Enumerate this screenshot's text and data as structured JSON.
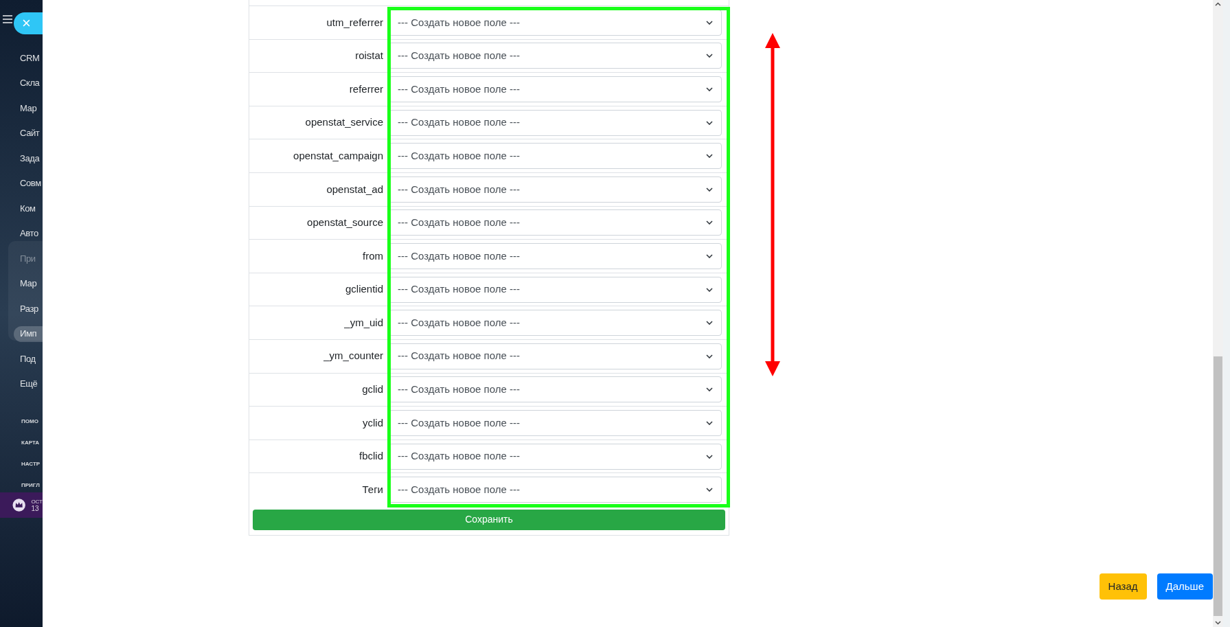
{
  "sidebar": {
    "close_button": "×",
    "items": [
      {
        "label": "CRM",
        "dimmed": false,
        "selected": false
      },
      {
        "label": "Скла",
        "dimmed": false,
        "selected": false
      },
      {
        "label": "Мар",
        "dimmed": false,
        "selected": false
      },
      {
        "label": "Сайт",
        "dimmed": false,
        "selected": false
      },
      {
        "label": "Зада",
        "dimmed": false,
        "selected": false
      },
      {
        "label": "Совм",
        "dimmed": false,
        "selected": false
      },
      {
        "label": "Ком",
        "dimmed": false,
        "selected": false
      },
      {
        "label": "Авто",
        "dimmed": false,
        "selected": false
      },
      {
        "label": "При",
        "dimmed": true,
        "selected": false
      },
      {
        "label": "Мар",
        "dimmed": false,
        "selected": false
      },
      {
        "label": "Разр",
        "dimmed": false,
        "selected": false
      },
      {
        "label": "Имп",
        "dimmed": false,
        "selected": true
      },
      {
        "label": "Под",
        "dimmed": false,
        "selected": false
      },
      {
        "label": "Ещё",
        "dimmed": false,
        "selected": false
      }
    ],
    "links": [
      "ПОМО",
      "КАРТА",
      "НАСТР",
      "ПРИГЛ"
    ],
    "plan": {
      "line_1": "ОСТ",
      "line_2": "13"
    }
  },
  "mapping": {
    "rows": [
      {
        "field": "utm_referrer",
        "value": "--- Создать новое поле ---"
      },
      {
        "field": "roistat",
        "value": "--- Создать новое поле ---"
      },
      {
        "field": "referrer",
        "value": "--- Создать новое поле ---"
      },
      {
        "field": "openstat_service",
        "value": "--- Создать новое поле ---"
      },
      {
        "field": "openstat_campaign",
        "value": "--- Создать новое поле ---"
      },
      {
        "field": "openstat_ad",
        "value": "--- Создать новое поле ---"
      },
      {
        "field": "openstat_source",
        "value": "--- Создать новое поле ---"
      },
      {
        "field": "from",
        "value": "--- Создать новое поле ---"
      },
      {
        "field": "gclientid",
        "value": "--- Создать новое поле ---"
      },
      {
        "field": "_ym_uid",
        "value": "--- Создать новое поле ---"
      },
      {
        "field": "_ym_counter",
        "value": "--- Создать новое поле ---"
      },
      {
        "field": "gclid",
        "value": "--- Создать новое поле ---"
      },
      {
        "field": "yclid",
        "value": "--- Создать новое поле ---"
      },
      {
        "field": "fbclid",
        "value": "--- Создать новое поле ---"
      },
      {
        "field": "Теги",
        "value": "--- Создать новое поле ---"
      }
    ],
    "save_button": "Сохранить"
  },
  "annotations": {
    "highlight_frame": true,
    "double_arrow": true
  },
  "footer": {
    "back_button": "Назад",
    "next_button": "Дальше"
  }
}
